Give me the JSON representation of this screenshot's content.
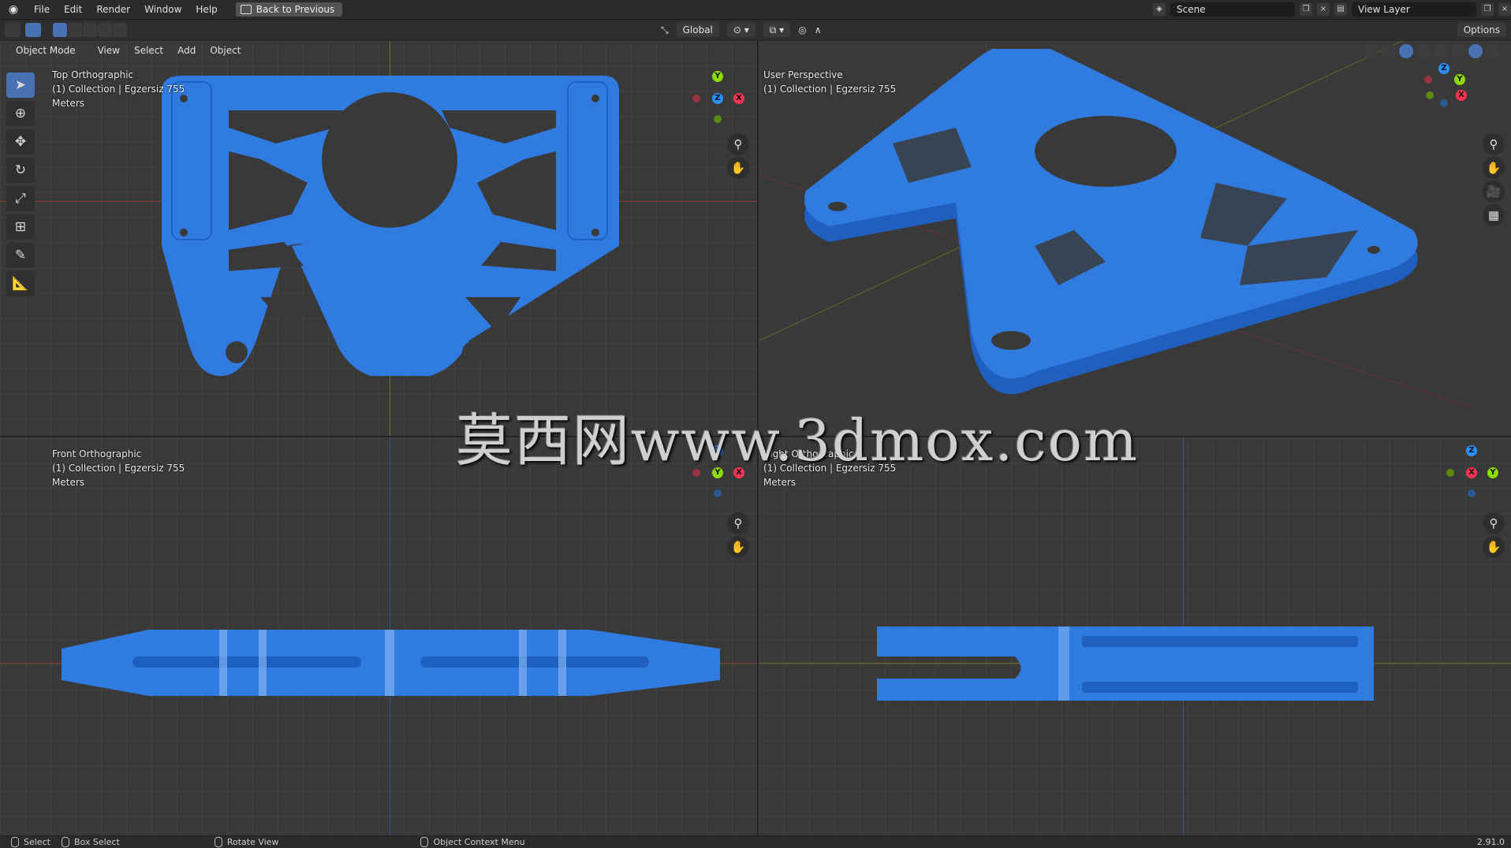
{
  "topbar": {
    "menus": [
      "File",
      "Edit",
      "Render",
      "Window",
      "Help"
    ],
    "back_button": "Back to Previous",
    "scene": "Scene",
    "view_layer": "View Layer"
  },
  "toolbar": {
    "transform_orientation": "Global",
    "options": "Options"
  },
  "viewport_header": {
    "mode": "Object Mode",
    "menus": [
      "View",
      "Select",
      "Add",
      "Object"
    ]
  },
  "viewports": {
    "top_left": {
      "view": "Top Orthographic",
      "collection": "(1) Collection | Egzersiz 755",
      "units": "Meters"
    },
    "top_right": {
      "view": "User Perspective",
      "collection": "(1) Collection | Egzersiz 755",
      "units": ""
    },
    "bottom_left": {
      "view": "Front Orthographic",
      "collection": "(1) Collection | Egzersiz 755",
      "units": "Meters"
    },
    "bottom_right": {
      "view": "Right Orthographic",
      "collection": "(1) Collection | Egzersiz 755",
      "units": "Meters"
    }
  },
  "gizmo_labels": {
    "x": "X",
    "y": "Y",
    "z": "Z"
  },
  "statusbar": {
    "select": "Select",
    "box_select": "Box Select",
    "rotate_view": "Rotate View",
    "context_menu": "Object Context Menu",
    "version": "2.91.0"
  },
  "watermark": "莫西网www.3dmox.com",
  "colors": {
    "part": "#2f7be0",
    "accent": "#4772b3",
    "x_axis": "#ff3352",
    "y_axis": "#8bdc00",
    "z_axis": "#2890ff"
  }
}
